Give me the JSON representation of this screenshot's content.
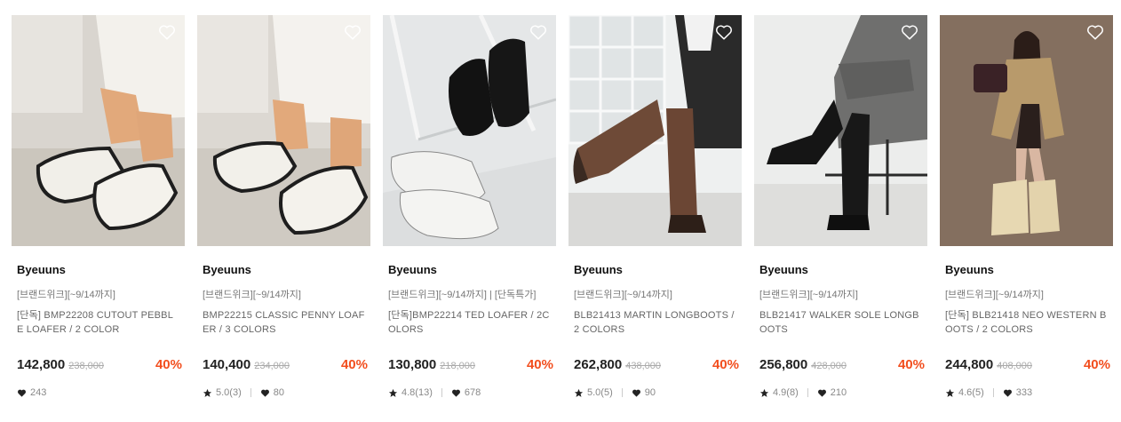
{
  "colors": {
    "discount": "#f24e1e",
    "text": "#222222",
    "muted": "#888888"
  },
  "products": [
    {
      "brand": "Byeuuns",
      "promo": "[브랜드위크][~9/14까지]",
      "name": "[단독] BMP22208 CUTOUT PEBBLE LOAFER / 2 color",
      "price": "142,800",
      "original_price": "238,000",
      "discount": "40%",
      "rating": "",
      "likes": "243",
      "image": "cream loafers with knit socks on sand"
    },
    {
      "brand": "Byeuuns",
      "promo": "[브랜드위크][~9/14까지]",
      "name": "BMP22215 CLASSIC PENNY LOAFER / 3 COLORS",
      "price": "140,400",
      "original_price": "234,000",
      "discount": "40%",
      "rating": "5.0(3)",
      "likes": "80",
      "image": "cream penny loafers with knit socks"
    },
    {
      "brand": "Byeuuns",
      "promo": "[브랜드위크][~9/14까지] | [단독특가]",
      "name": "[단독]BMP22214 TED LOAFER / 2COLORS",
      "price": "130,800",
      "original_price": "218,000",
      "discount": "40%",
      "rating": "4.8(13)",
      "likes": "678",
      "image": "black and white lace-up shoes on glass"
    },
    {
      "brand": "Byeuuns",
      "promo": "[브랜드위크][~9/14까지]",
      "name": "BLB21413 MARTIN LONGBOOTS / 2 COLORS",
      "price": "262,800",
      "original_price": "438,000",
      "discount": "40%",
      "rating": "5.0(5)",
      "likes": "90",
      "image": "brown long boots against glass block wall"
    },
    {
      "brand": "Byeuuns",
      "promo": "[브랜드위크][~9/14까지]",
      "name": "BLB21417 WALKER SOLE LONGBOOTS",
      "price": "256,800",
      "original_price": "428,000",
      "discount": "40%",
      "rating": "4.9(8)",
      "likes": "210",
      "image": "black long boots seated on chair"
    },
    {
      "brand": "Byeuuns",
      "promo": "[브랜드위크][~9/14까지]",
      "name": "[단독] BLB21418 NEO WESTERN BOOTS / 2 COLORS",
      "price": "244,800",
      "original_price": "408,000",
      "discount": "40%",
      "rating": "4.6(5)",
      "likes": "333",
      "image": "woman in beige western boots and coat"
    }
  ]
}
